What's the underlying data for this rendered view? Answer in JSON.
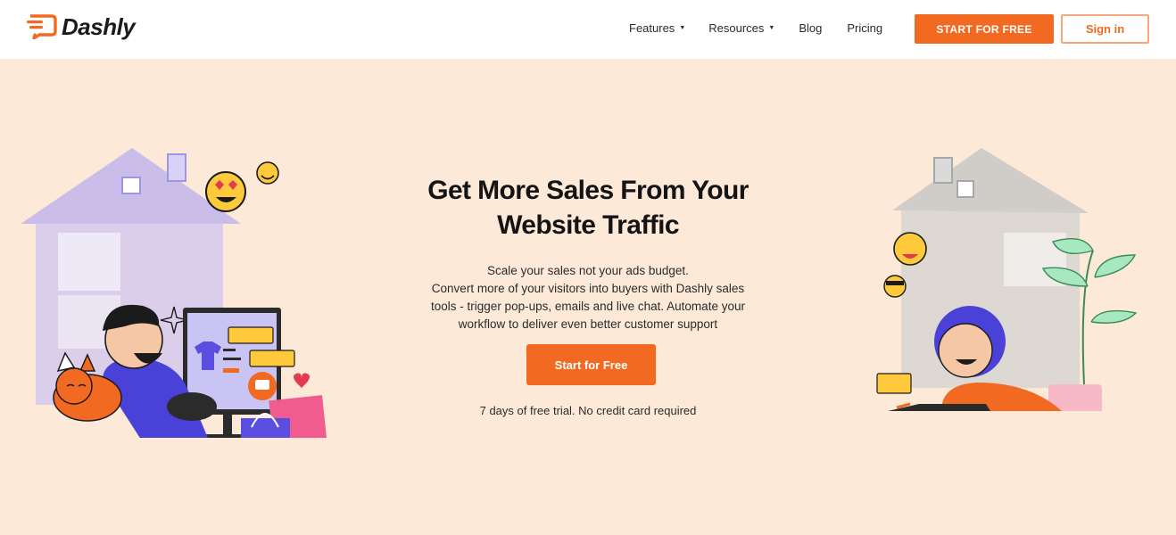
{
  "brand": {
    "name": "Dashly",
    "accent_color": "#f26a22",
    "hero_bg": "#fde9d8"
  },
  "nav": {
    "items": [
      {
        "label": "Features",
        "has_dropdown": true
      },
      {
        "label": "Resources",
        "has_dropdown": true
      },
      {
        "label": "Blog",
        "has_dropdown": false
      },
      {
        "label": "Pricing",
        "has_dropdown": false
      }
    ],
    "dropdown_icon": "caret-down-icon",
    "start_label": "START FOR FREE",
    "signin_label": "Sign in"
  },
  "hero": {
    "title_line1": "Get More Sales From Your",
    "title_line2": "Website Traffic",
    "subtitle_line1": "Scale your sales not your ads budget.",
    "subtitle_line2": "Convert more of your visitors into buyers with Dashly sales",
    "subtitle_line3": "tools - trigger pop-ups, emails and live chat. Automate your",
    "subtitle_line4": "workflow to deliver even better customer support",
    "cta_label": "Start for Free",
    "note": "7 days of free trial. No credit card required"
  },
  "illustrations": {
    "left": "man-with-cat-at-computer-illustration",
    "right": "woman-with-laptop-illustration"
  }
}
